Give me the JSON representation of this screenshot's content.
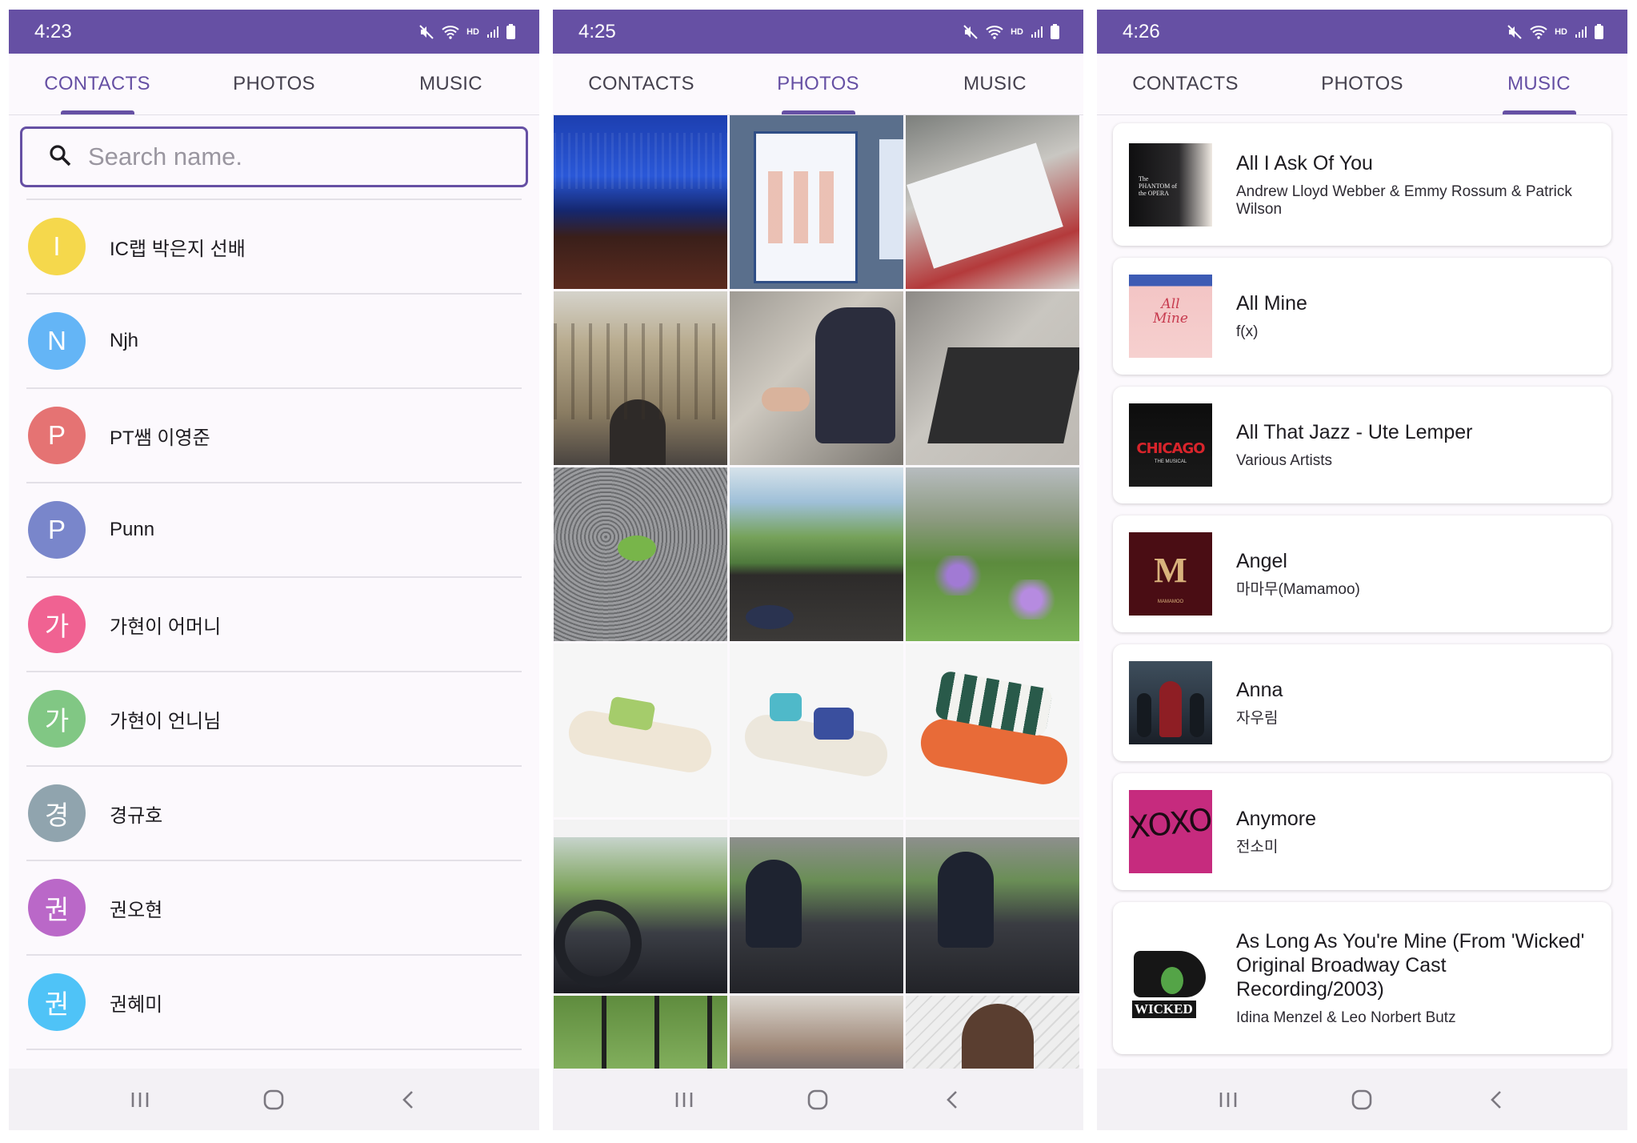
{
  "colors": {
    "primary": "#6650a4",
    "surface": "#fcf9fd"
  },
  "screens": [
    {
      "time": "4:23",
      "active_tab": "contacts"
    },
    {
      "time": "4:25",
      "active_tab": "photos"
    },
    {
      "time": "4:26",
      "active_tab": "music"
    }
  ],
  "tabs": {
    "contacts": "CONTACTS",
    "photos": "PHOTOS",
    "music": "MUSIC"
  },
  "status_icons": [
    "mute-icon",
    "wifi-icon",
    "hd-voice-icon",
    "signal-icon",
    "battery-icon"
  ],
  "status_hd_label": "HD",
  "search": {
    "placeholder": "Search name."
  },
  "contacts": [
    {
      "initial": "I",
      "name": "IC랩 박은지 선배",
      "color": "#f5d84c"
    },
    {
      "initial": "N",
      "name": "Njh",
      "color": "#64b5f6"
    },
    {
      "initial": "P",
      "name": "PT쌤 이영준",
      "color": "#e57373"
    },
    {
      "initial": "P",
      "name": "Punn",
      "color": "#7986cb"
    },
    {
      "initial": "가",
      "name": "가현이 어머니",
      "color": "#f06292"
    },
    {
      "initial": "가",
      "name": "가현이 언니님",
      "color": "#81c784"
    },
    {
      "initial": "경",
      "name": "경규호",
      "color": "#90a4ae"
    },
    {
      "initial": "권",
      "name": "권오현",
      "color": "#ba68c8"
    },
    {
      "initial": "권",
      "name": "권혜미",
      "color": "#4fc3f7"
    }
  ],
  "photos": [
    "theater-stage",
    "casting-board",
    "ticket-envelope",
    "gothic-building",
    "person-crouching",
    "doormat-shadow",
    "green-frog",
    "window-mountain-view",
    "garden-flowers",
    "sandal-green",
    "sandal-blue",
    "sandal-orange",
    "car-driving",
    "car-passenger-victory",
    "car-passenger",
    "window-greenery",
    "person-reading",
    "person-long-hair"
  ],
  "music": [
    {
      "title": "All I Ask Of You",
      "artist": "Andrew Lloyd Webber & Emmy Rossum & Patrick Wilson",
      "cover": "phantom-cover"
    },
    {
      "title": "All Mine",
      "artist": "f(x)",
      "cover": "all-mine-cover"
    },
    {
      "title": "All That Jazz - Ute Lemper",
      "artist": "Various Artists",
      "cover": "chicago-cover"
    },
    {
      "title": "Angel",
      "artist": "마마무(Mamamoo)",
      "cover": "mamamoo-cover"
    },
    {
      "title": "Anna",
      "artist": "자우림",
      "cover": "anna-cover"
    },
    {
      "title": "Anymore",
      "artist": "전소미",
      "cover": "xoxo-cover"
    },
    {
      "title": "As Long As You're Mine (From 'Wicked' Original Broadway Cast Recording/2003)",
      "artist": "Idina Menzel & Leo Norbert Butz",
      "cover": "wicked-cover"
    }
  ],
  "cover_text": {
    "phantom": "The PHANTOM of the OPERA",
    "allmine": "All Mine",
    "chicago": "CHICAGO",
    "chicago_sub": "THE MUSICAL",
    "mamamoo": "M",
    "mamamoo_sub": "MAMAMOO",
    "xoxo": "XOXO",
    "wicked": "WICKED"
  },
  "nav": [
    "recent-apps-icon",
    "home-icon",
    "back-icon"
  ]
}
